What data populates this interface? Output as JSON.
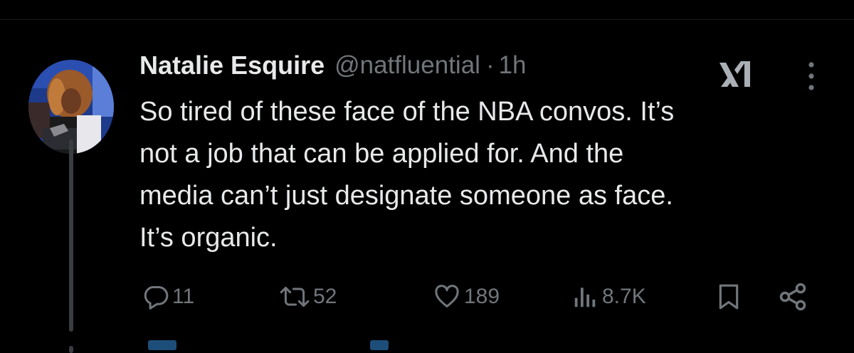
{
  "tweet": {
    "author_name": "Natalie Esquire",
    "handle": "@natfluential",
    "separator": "·",
    "time": "1h",
    "text_lines": [
      "So tired of these face of the NBA convos. It’s",
      "not a job that can be applied for. And the",
      "media can’t just designate someone as face.",
      "It’s organic."
    ]
  },
  "actions": {
    "reply_count": "11",
    "retweet_count": "52",
    "like_count": "189",
    "views_count": "8.7K"
  },
  "icons": {
    "grok": "grok-icon",
    "more": "more-vertical-icon",
    "reply": "reply-icon",
    "retweet": "retweet-icon",
    "like": "heart-icon",
    "views": "views-icon",
    "bookmark": "bookmark-icon",
    "share": "share-icon"
  },
  "colors": {
    "background": "#000000",
    "primary_text": "#e7e9ea",
    "secondary_text": "#71767b"
  }
}
